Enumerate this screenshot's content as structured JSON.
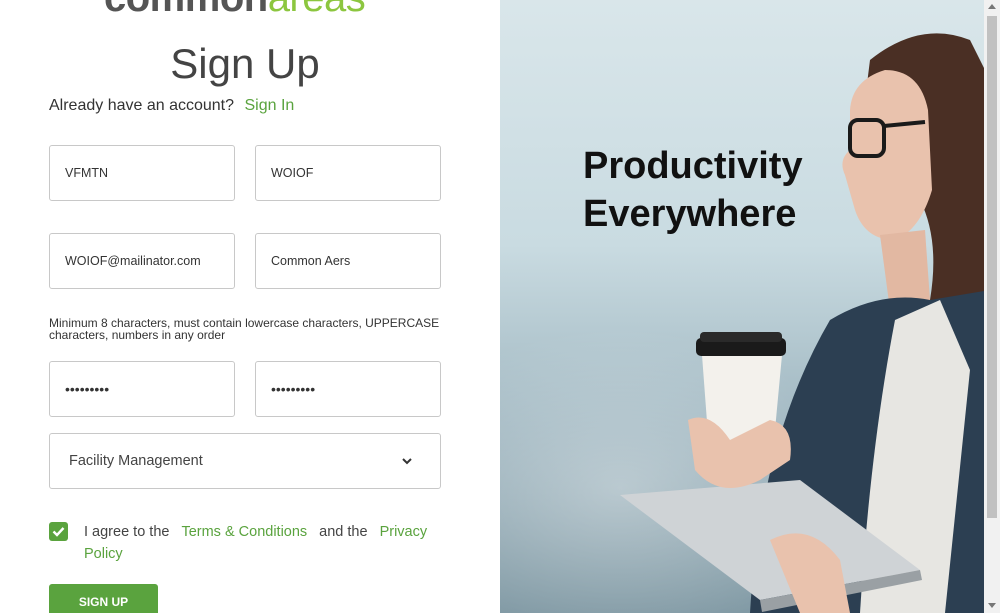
{
  "logo": {
    "part1": "common",
    "part2": "areas"
  },
  "title": "Sign Up",
  "signin": {
    "prompt": "Already have an account?",
    "link": "Sign In"
  },
  "fields": {
    "first_name": "VFMTN",
    "last_name": "WOIOF",
    "email": "WOIOF@mailinator.com",
    "company": "Common Aers",
    "password": "•••••••••",
    "confirm_password": "•••••••••"
  },
  "password_hint": "Minimum 8 characters, must contain lowercase characters, UPPERCASE characters, numbers in any order",
  "role_select": {
    "selected": "Facility Management"
  },
  "agreement": {
    "checked": true,
    "text1": "I agree to the",
    "terms": "Terms & Conditions",
    "text2": "and the",
    "privacy": "Privacy Policy"
  },
  "signup_button": "SIGN UP",
  "hero": {
    "line1": "Productivity",
    "line2": "Everywhere"
  },
  "colors": {
    "accent": "#5aa33e",
    "logo_green": "#8cc63f"
  }
}
